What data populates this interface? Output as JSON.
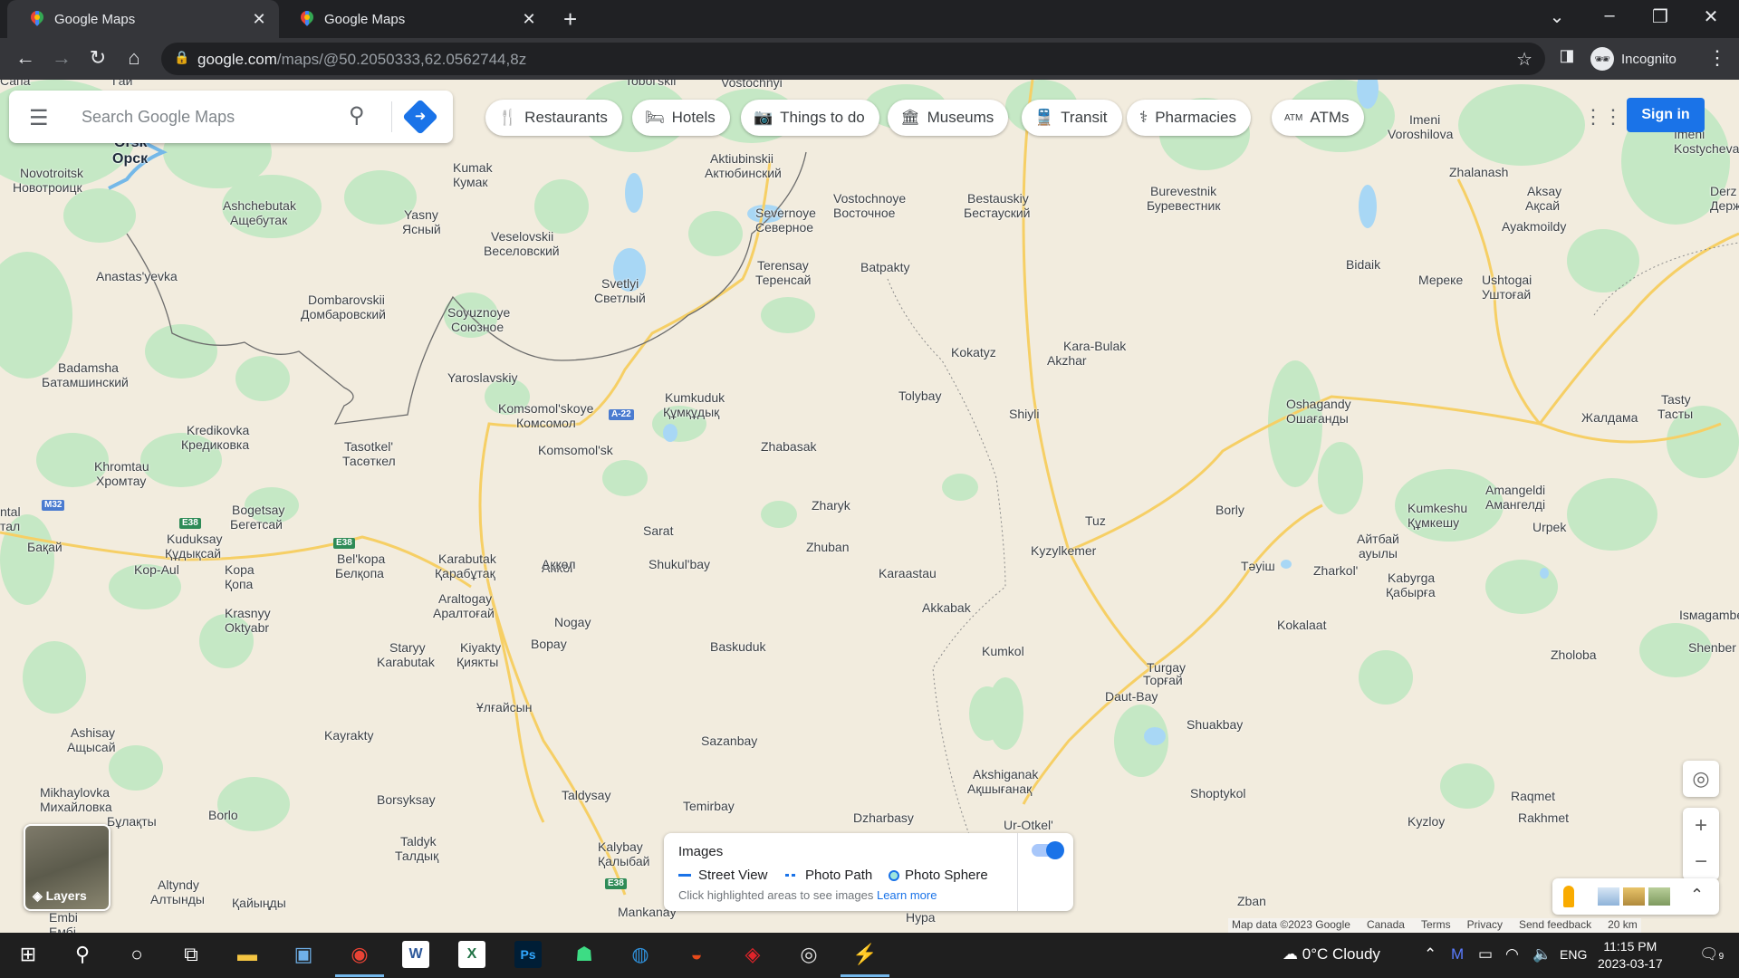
{
  "browser": {
    "tabs": [
      {
        "title": "Google Maps",
        "active": true
      },
      {
        "title": "Google Maps",
        "active": false
      }
    ],
    "url_host": "google.com",
    "url_path": "/maps/@50.2050333,62.0562744,8z",
    "profile_label": "Incognito"
  },
  "maps": {
    "search_placeholder": "Search Google Maps",
    "chips": [
      {
        "icon": "restaurant-icon",
        "glyph": "🍴",
        "label": "Restaurants"
      },
      {
        "icon": "hotel-icon",
        "glyph": "🛏",
        "label": "Hotels"
      },
      {
        "icon": "camera-icon",
        "glyph": "📷",
        "label": "Things to do"
      },
      {
        "icon": "museum-icon",
        "glyph": "🏛",
        "label": "Museums"
      },
      {
        "icon": "transit-icon",
        "glyph": "🚆",
        "label": "Transit"
      },
      {
        "icon": "pharmacy-icon",
        "glyph": "⚕",
        "label": "Pharmacies"
      },
      {
        "icon": "atm-icon",
        "glyph": "ATM",
        "label": "ATMs"
      }
    ],
    "sign_in": "Sign in",
    "layers_label": "Layers",
    "images_panel": {
      "title": "Images",
      "street_view": "Street View",
      "photo_path": "Photo Path",
      "photo_sphere": "Photo Sphere",
      "hint": "Click highlighted areas to see images",
      "learn_more": "Learn more"
    },
    "footer": {
      "map_data": "Map data ©2023 Google",
      "country": "Canada",
      "terms": "Terms",
      "privacy": "Privacy",
      "feedback": "Send feedback",
      "scale": "20 km"
    },
    "places": [
      {
        "t": "Сапа"
      },
      {
        "t": "Гай"
      },
      {
        "t": "Tobol'skii"
      },
      {
        "t": "Vostochnyi"
      },
      {
        "t": "Orsk"
      },
      {
        "t": "Орск"
      },
      {
        "t": "Novotroitsk"
      },
      {
        "t": "Новотроицк"
      },
      {
        "t": "Kumak"
      },
      {
        "t": "Кумак"
      },
      {
        "t": "Aktiubinskii"
      },
      {
        "t": "Актюбинский"
      },
      {
        "t": "Ashchebutak"
      },
      {
        "t": "Ащебутак"
      },
      {
        "t": "Yasny"
      },
      {
        "t": "Ясный"
      },
      {
        "t": "Severnoye"
      },
      {
        "t": "Северное"
      },
      {
        "t": "Vostochnoye"
      },
      {
        "t": "Восточное"
      },
      {
        "t": "Bestauskiy"
      },
      {
        "t": "Бестауский"
      },
      {
        "t": "Burevestnik"
      },
      {
        "t": "Буревестник"
      },
      {
        "t": "Imeni"
      },
      {
        "t": "Voroshilova"
      },
      {
        "t": "Imeni"
      },
      {
        "t": "Kostycheva"
      },
      {
        "t": "Zhalanash"
      },
      {
        "t": "Aksay"
      },
      {
        "t": "Ақсай"
      },
      {
        "t": "Derz"
      },
      {
        "t": "Держ"
      },
      {
        "t": "Veselovskii"
      },
      {
        "t": "Веселовский"
      },
      {
        "t": "Ayakmoildy"
      },
      {
        "t": "Anastas'yevka"
      },
      {
        "t": "Terensay"
      },
      {
        "t": "Теренсай"
      },
      {
        "t": "Batpakty"
      },
      {
        "t": "Bidaik"
      },
      {
        "t": "Svetlyi"
      },
      {
        "t": "Светлый"
      },
      {
        "t": "Мереке"
      },
      {
        "t": "Ushtogai"
      },
      {
        "t": "Уштоғай"
      },
      {
        "t": "Dombarovskii"
      },
      {
        "t": "Домбаровский"
      },
      {
        "t": "Soyuznoye"
      },
      {
        "t": "Союзное"
      },
      {
        "t": "Kokatyz"
      },
      {
        "t": "Kara-Bulak"
      },
      {
        "t": "Akzhar"
      },
      {
        "t": "Badamsha"
      },
      {
        "t": "Батамшинский"
      },
      {
        "t": "Yaroslavskiy"
      },
      {
        "t": "Kumkuduk"
      },
      {
        "t": "Құмқұдық"
      },
      {
        "t": "Tolybay"
      },
      {
        "t": "Oshagandy"
      },
      {
        "t": "Ошағанды"
      },
      {
        "t": "Tasty"
      },
      {
        "t": "Тасты"
      },
      {
        "t": "Комсомол"
      },
      {
        "t": "Komsomol'skoye"
      },
      {
        "t": "Shiyli"
      },
      {
        "t": "Жалдама"
      },
      {
        "t": "Kredikovka"
      },
      {
        "t": "Кредиковка"
      },
      {
        "t": "Tasotkel'"
      },
      {
        "t": "Тасөткел"
      },
      {
        "t": "Komsomol'sk"
      },
      {
        "t": "Zhabasak"
      },
      {
        "t": "Khromtau"
      },
      {
        "t": "Хромтау"
      },
      {
        "t": "Amangeldi"
      },
      {
        "t": "Амангелді"
      },
      {
        "t": "Bogetsay"
      },
      {
        "t": "Бегетсай"
      },
      {
        "t": "Zharyk"
      },
      {
        "t": "Borly"
      },
      {
        "t": "Kumkeshu"
      },
      {
        "t": "Құмкешу"
      },
      {
        "t": "Urpek"
      },
      {
        "t": "Tuz"
      },
      {
        "t": "Sarat"
      },
      {
        "t": "Kuduksay"
      },
      {
        "t": "Құдықсай"
      },
      {
        "t": "Бақай"
      },
      {
        "t": "ntal"
      },
      {
        "t": "тал"
      },
      {
        "t": "Айтбай"
      },
      {
        "t": "ауылы"
      },
      {
        "t": "Zhuban"
      },
      {
        "t": "Kyzylkemer"
      },
      {
        "t": "Bel'kopa"
      },
      {
        "t": "Белқопа"
      },
      {
        "t": "Karabutak"
      },
      {
        "t": "Қарабұтақ"
      },
      {
        "t": "Akkol'"
      },
      {
        "t": "Ақкөл"
      },
      {
        "t": "Shukul'bay"
      },
      {
        "t": "Karaastau"
      },
      {
        "t": "Тәуіш"
      },
      {
        "t": "Zharkol'"
      },
      {
        "t": "Kabyrga"
      },
      {
        "t": "Қабырға"
      },
      {
        "t": "Kop-Aul"
      },
      {
        "t": "Kopa"
      },
      {
        "t": "Қопа"
      },
      {
        "t": "Araltogay"
      },
      {
        "t": "Аралтоғай"
      },
      {
        "t": "Akkabak"
      },
      {
        "t": "Nogay"
      },
      {
        "t": "Krasnyy"
      },
      {
        "t": "Oktyabr"
      },
      {
        "t": "Kokalaat"
      },
      {
        "t": "Isмagambet"
      },
      {
        "t": "Staryy"
      },
      {
        "t": "Karabutak"
      },
      {
        "t": "Kiyakty"
      },
      {
        "t": "Қиякты"
      },
      {
        "t": "Bopay"
      },
      {
        "t": "Baskuduk"
      },
      {
        "t": "Kumkol"
      },
      {
        "t": "Turgay"
      },
      {
        "t": "Торғай"
      },
      {
        "t": "Zholoba"
      },
      {
        "t": "Shenber"
      },
      {
        "t": "Daut-Bay"
      },
      {
        "t": "Ұлғайсын"
      },
      {
        "t": "Shuakbay"
      },
      {
        "t": "Sazanbay"
      },
      {
        "t": "Kayrakty"
      },
      {
        "t": "Ashisay"
      },
      {
        "t": "Ащысай"
      },
      {
        "t": "Akshiganak"
      },
      {
        "t": "Ақшығанақ"
      },
      {
        "t": "Shoptykol"
      },
      {
        "t": "Raqmet"
      },
      {
        "t": "Rakhmet"
      },
      {
        "t": "Mikhaylovka"
      },
      {
        "t": "Михайловка"
      },
      {
        "t": "Borsyksay"
      },
      {
        "t": "Taldysay"
      },
      {
        "t": "Temirbay"
      },
      {
        "t": "Borlo"
      },
      {
        "t": "Бұлақты"
      },
      {
        "t": "Dzharbasy"
      },
      {
        "t": "Ur-Otkel'"
      },
      {
        "t": "Kyzloy"
      },
      {
        "t": "Taldyk"
      },
      {
        "t": "Талдық"
      },
      {
        "t": "Kalybay"
      },
      {
        "t": "Қалыбай"
      },
      {
        "t": "Altyndy"
      },
      {
        "t": "Алтынды"
      },
      {
        "t": "Қайыңды"
      },
      {
        "t": "Embi"
      },
      {
        "t": "Ембі"
      },
      {
        "t": "Mankanay"
      },
      {
        "t": "Нура"
      },
      {
        "t": "Zban"
      }
    ],
    "shields": [
      {
        "t": "A-22",
        "color": "blue"
      },
      {
        "t": "M32",
        "color": "blue"
      },
      {
        "t": "E38",
        "color": "green"
      },
      {
        "t": "E38",
        "color": "green"
      },
      {
        "t": "E38",
        "color": "green"
      }
    ]
  },
  "taskbar": {
    "weather": "0°C  Cloudy",
    "lang": "ENG",
    "time": "11:15 PM",
    "date": "2023-03-17",
    "notif_count": "9"
  },
  "colors": {
    "map_land": "#f2ecde",
    "park": "#c5e8c5",
    "water": "#a8d7f5",
    "accent": "#1a73e8",
    "road": "#f6cf65"
  }
}
